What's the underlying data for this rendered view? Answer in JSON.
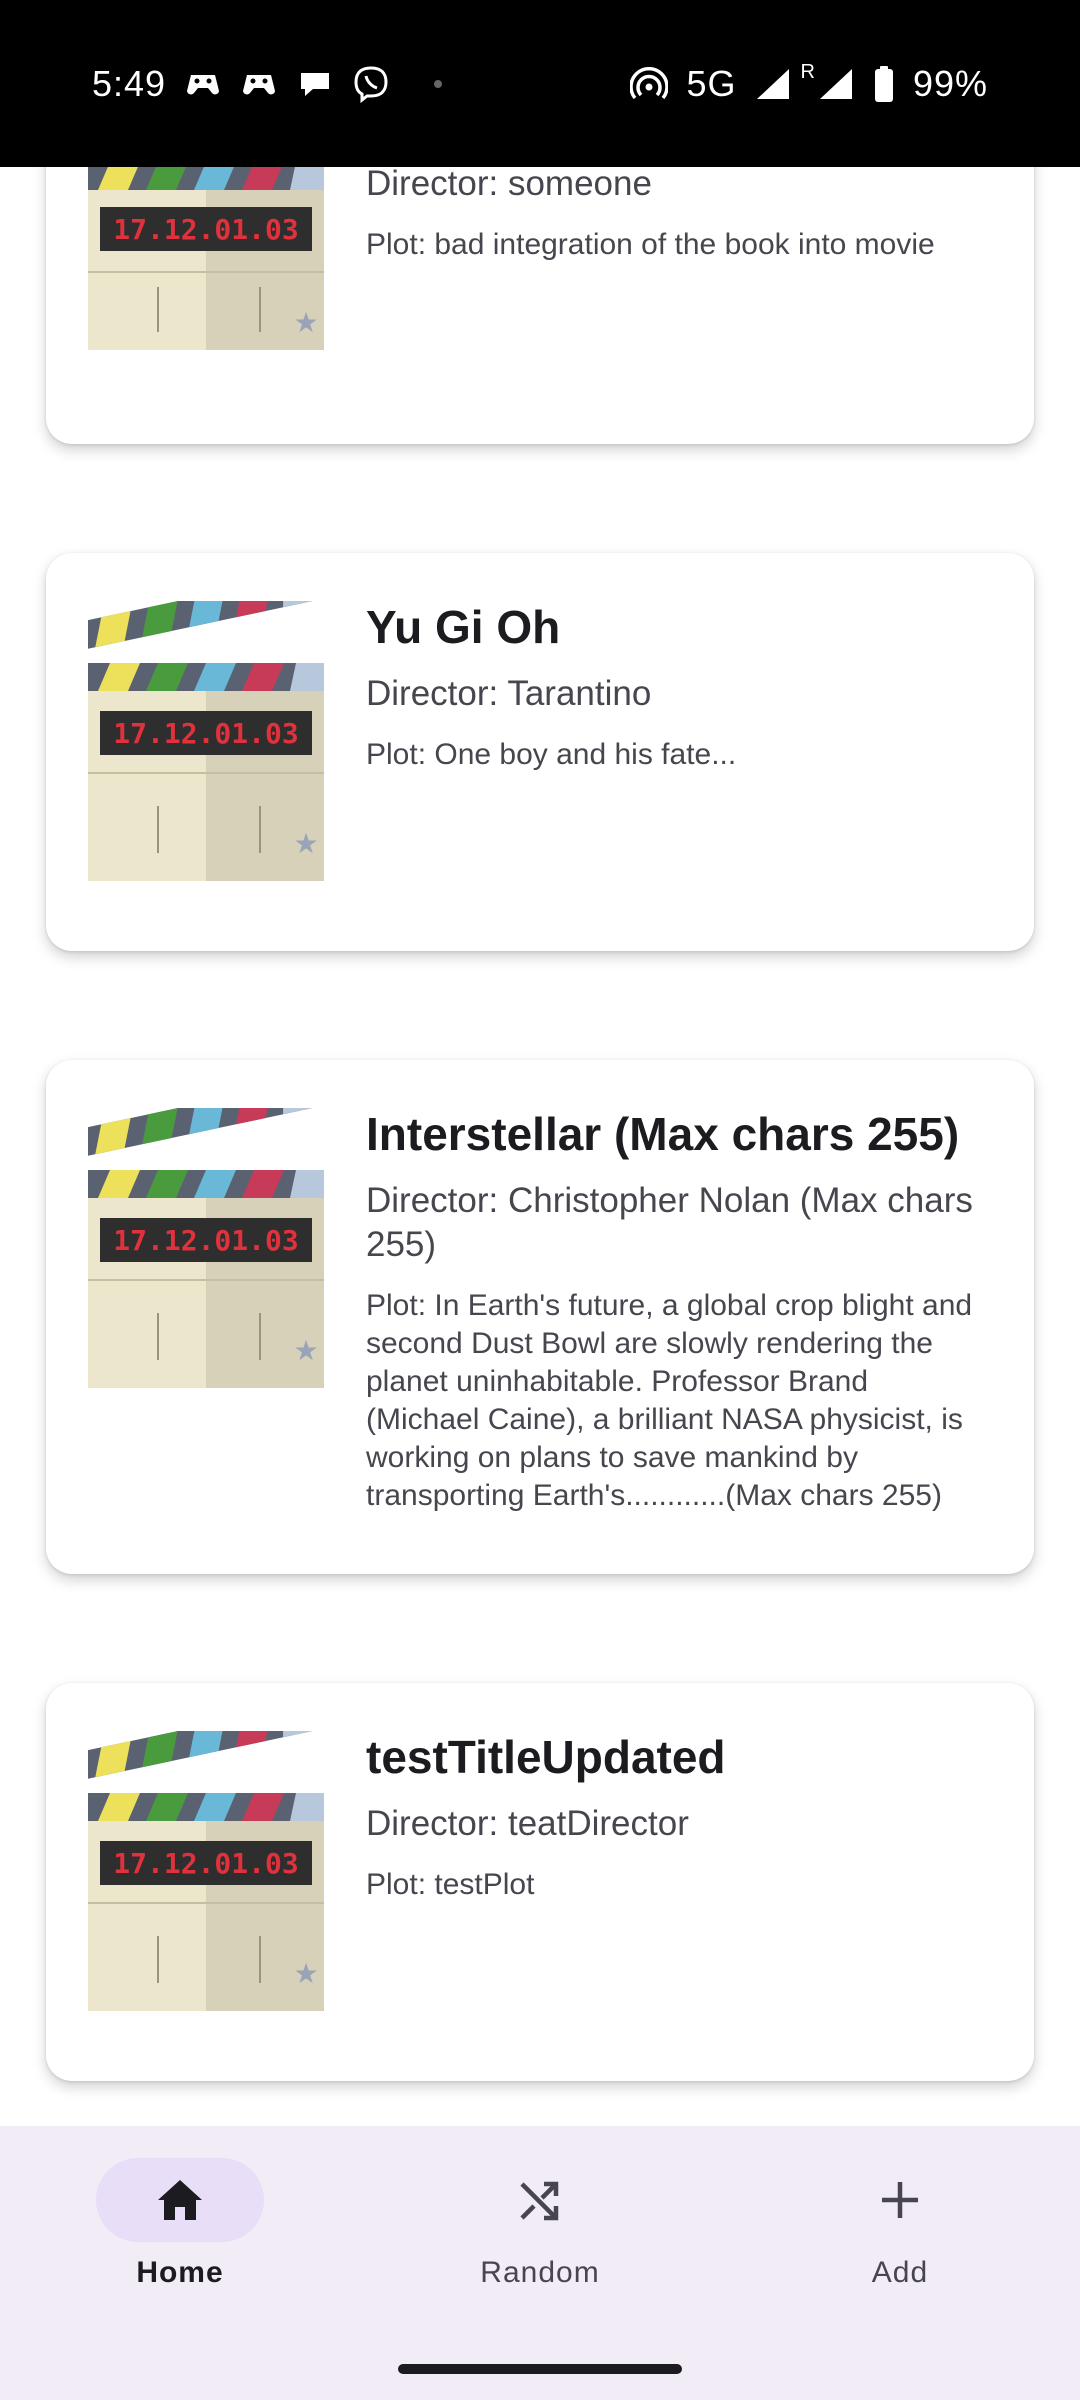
{
  "status_bar": {
    "time": "5:49",
    "network": "5G",
    "roaming": "R",
    "battery": "99%",
    "notification_icons": [
      "game-controller-icon",
      "game-controller-icon",
      "chat-bubble-icon",
      "viber-icon"
    ]
  },
  "movies": [
    {
      "title": "",
      "director": "Director: someone",
      "plot": "Plot: bad integration of the book into movie",
      "poster_label": "17.12.01.03"
    },
    {
      "title": "Yu Gi Oh",
      "director": "Director: Tarantino",
      "plot": "Plot: One boy and his fate...",
      "poster_label": "17.12.01.03"
    },
    {
      "title": "Interstellar (Max chars 255)",
      "director": "Director: Christopher Nolan (Max chars 255)",
      "plot": "Plot: In Earth's future, a global crop blight and second Dust Bowl are slowly rendering the planet uninhabitable. Professor Brand (Michael Caine), a brilliant NASA physicist, is working on plans to save mankind by transporting Earth's............(Max chars 255)",
      "poster_label": "17.12.01.03"
    },
    {
      "title": "testTitleUpdated",
      "director": "Director: teatDirector",
      "plot": "Plot: testPlot",
      "poster_label": "17.12.01.03"
    }
  ],
  "nav": {
    "home_label": "Home",
    "random_label": "Random",
    "add_label": "Add",
    "active": "Home"
  },
  "colors": {
    "nav_background": "#f1ecf6",
    "nav_active_pill": "#e8def8",
    "poster_label": "#e0323c"
  }
}
